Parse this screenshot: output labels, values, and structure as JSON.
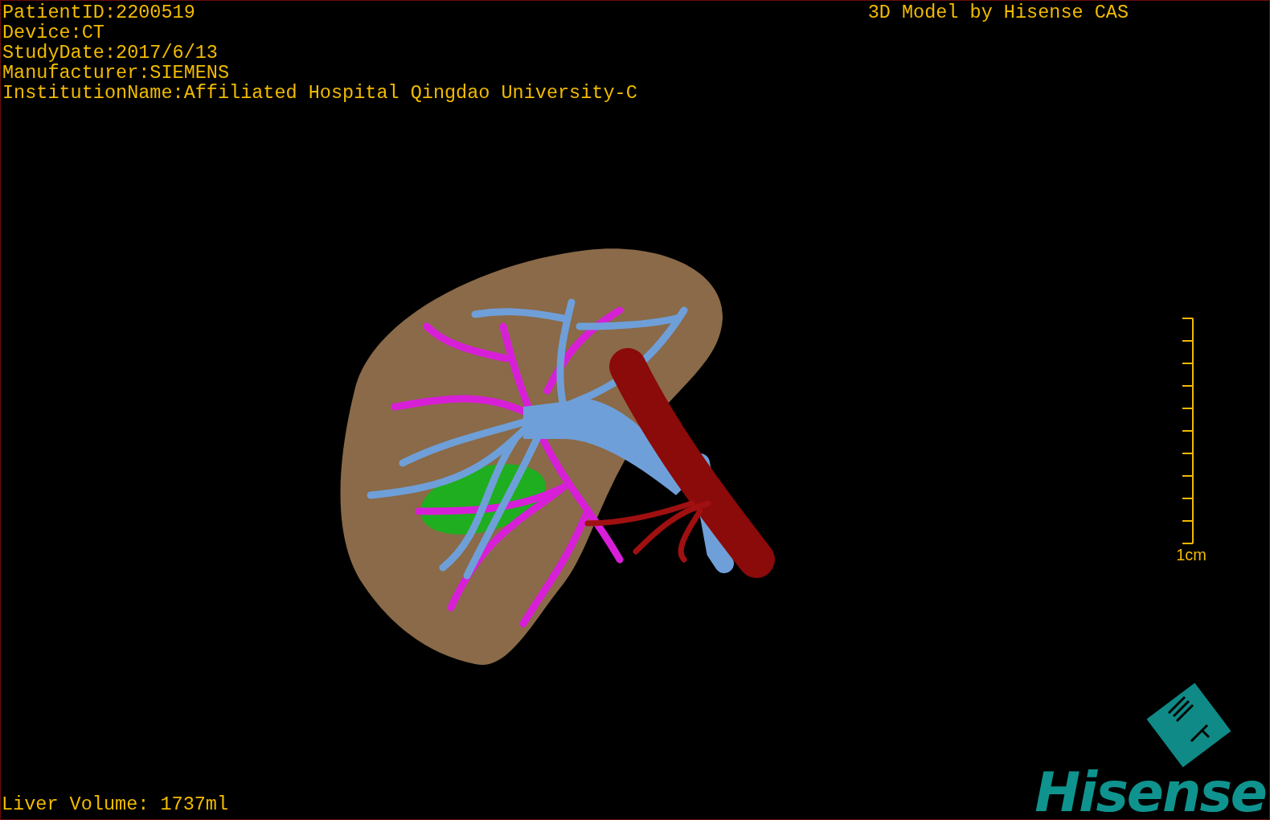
{
  "patient_info": [
    "PatientID:2200519",
    "Device:CT",
    "StudyDate:2017/6/13",
    "Manufacturer:SIEMENS",
    "InstitutionName:Affiliated Hospital Qingdao University-C"
  ],
  "header_title": "3D Model by Hisense CAS",
  "scale_bar": {
    "label": "1cm"
  },
  "liver_volume": "Liver Volume: 1737ml",
  "logo": {
    "wordmark": "Hisense"
  }
}
